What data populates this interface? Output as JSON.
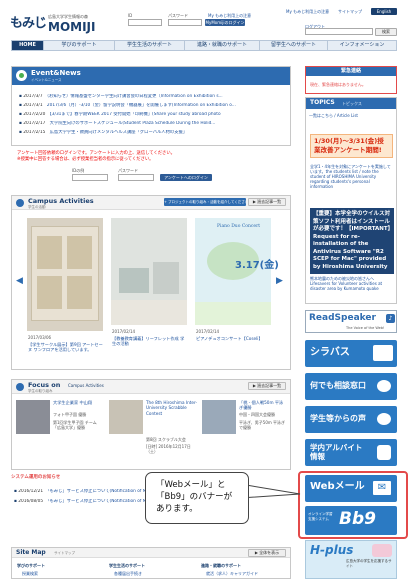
{
  "header": {
    "logo_main": "もみじ",
    "logo_sub": "広島大学学生情報の森",
    "logo_en": "MOMIJI",
    "id_label": "ID",
    "password_label": "パスワード",
    "login_link": "MyMomijiのログイン",
    "logout_link": "ログアウト",
    "search_label": "検索",
    "site_links": [
      "My もみじ利用上の注意",
      "サイトマップ",
      "English"
    ],
    "lang_btn": "English"
  },
  "nav": [
    "HOME",
    "学びのサポート",
    "学生生活のサポート",
    "進路・就職のサポート",
    "留学生へのサポート",
    "インフォメーション"
  ],
  "event": {
    "title": "Event&News",
    "subtitle": "イベント&ニュース",
    "items": [
      {
        "date": "2017/3/7",
        "text": "（お知らせ）情報基盤センター学生向け講習会の日程変更（Information on Exhibition s..."
      },
      {
        "date": "2017/3/1",
        "text": "2017/3/6（月）-3/10（金）留学説明会「機器展」を開催します(Information on Exhibition o..."
      },
      {
        "date": "2017/2/20",
        "text": "【3/31まで】春学期WEEK 2017 受付開始「印刷機」(Share your study abroad photo"
      },
      {
        "date": "2017/2/17",
        "text": "大学院生向けのサポートスケジュール(Student Plaza Schedule During the Holid..."
      },
      {
        "date": "2017/2/15",
        "text": "広島大学学生・教員向けメンタルヘルス講座「グローバル人材の支援」"
      }
    ]
  },
  "survey": {
    "line1": "アンケート回答依頼のログインです。アンケートに入力の上、送信してください。",
    "line2": "※授業中に回答する場合は、必ず授業担当者の指示に従ってください。",
    "id_label": "IDの例",
    "pw_label": "パスワード",
    "login_btn": "アンケートへのログイン"
  },
  "campus": {
    "title": "Campus Activities",
    "subtitle": "学生の活動",
    "nav_label": "+ プロジェクトの取り組み・活動を紹介してください",
    "more": "▶ 過去記事一覧",
    "items": [
      {
        "date": "2017/03/06",
        "caption": "【学生サークル展示】第9回 アートセーヌ ワンフロアを活用しています。"
      },
      {
        "date": "2017/02/14",
        "caption": "【教養教育講義】リーフレット作成 学生の活動"
      },
      {
        "date": "2017/02/14",
        "caption": "ピアノデュオコンサート【Coseli】"
      }
    ],
    "poster_title": "Piano Duo Concert",
    "poster_date": "3.17(金)"
  },
  "focus": {
    "title": "Focus on",
    "title2": "Campus Activities",
    "subtitle": "学生の取り組み",
    "more": "▶ 過去記事一覧",
    "items": [
      {
        "title": "大学生企業家 中山翔",
        "subtitle": "フォト甲子園 優勝",
        "text": "第1回学生甲子園 チーム「広島大学」優勝"
      },
      {
        "title": "The 8th Hiroshima Inter-University Scrabble Contest",
        "subtitle": "第8回 スクラブル大会",
        "text": "[日時] 2016年12月17日（土）"
      },
      {
        "title": "「桃 - 個人戦50m 平泳ぎ優勝",
        "subtitle": "中国・四国大会優勝",
        "text": "平泳ぎ、男子50m 平泳ぎで優勝"
      }
    ]
  },
  "system": {
    "title": "システム運用のお知らせ",
    "items": [
      {
        "date": "2016/12/21",
        "text": "「もみじ」サービス停止について(Notification of MOMIJI System Maintenance)"
      },
      {
        "date": "2016/08/05",
        "text": "「もみじ」サービス停止について(Notification of MOMIJI System Maintenance)"
      }
    ]
  },
  "sitemap": {
    "title": "Site Map",
    "subtitle": "サイトマップ",
    "more": "▶ 全体を表示",
    "cols": [
      {
        "head": "学びのサポート",
        "item": "授業検索"
      },
      {
        "head": "学生生活のサポート",
        "item": "各種届出手続き"
      },
      {
        "head": "進路・就職のサポート",
        "item": "就活（求人）キャリアガイド"
      }
    ]
  },
  "emergency": {
    "title": "緊急連絡",
    "text": "現在、緊急連絡はありません。"
  },
  "topics": {
    "title": "TOPICS",
    "subtitle": "トピックス",
    "label": "一覧はこちら / Article List",
    "red_banner": "1/30(月)～3/31(金)授業改善アンケート期間!",
    "text1": "全学1・4年生を対象にアンケートを実施しています。the students list / note the student of HIROSHIMA University regarding students's personal information",
    "virus_title": "【重要】本学全学のウイルス対策ソフト利用者はインストールが必要です！【IMPORTANT】Request for re-installation of the Antivirus Software \"R2 SCEP for Mac\" provided by Hiroshima University",
    "text2": "熊本地震のための被災地の皆さんへ Lifesavers for Volunteer activities at disaster area by Kumamoto quake"
  },
  "readspeaker": {
    "name": "ReadSpeaker",
    "tagline": "The Voice of the Web!"
  },
  "side_buttons": [
    {
      "label": "シラバス",
      "icon": "book-icon"
    },
    {
      "label": "何でも相談窓口",
      "icon": "chat-icon"
    },
    {
      "label": "学生等からの声",
      "icon": "people-icon"
    },
    {
      "label": "学内アルバイト情報",
      "icon": "worker-icon"
    },
    {
      "label": "Webメール",
      "icon": "mail-icon"
    },
    {
      "label": "Bb9",
      "icon": "bb9-logo"
    }
  ],
  "bb9_sub": "オンライン学習支援システム",
  "hplus": {
    "label": "H-plus",
    "sub": "広島大学の学生を応援するサイト"
  },
  "callout": {
    "line1": "「Webメール」と",
    "line2": "「Bb9」のバナーが",
    "line3": "あります。"
  },
  "colors": {
    "brand": "#1a3f6e",
    "accent": "#2d6bb0",
    "highlight": "#e34a4a"
  }
}
